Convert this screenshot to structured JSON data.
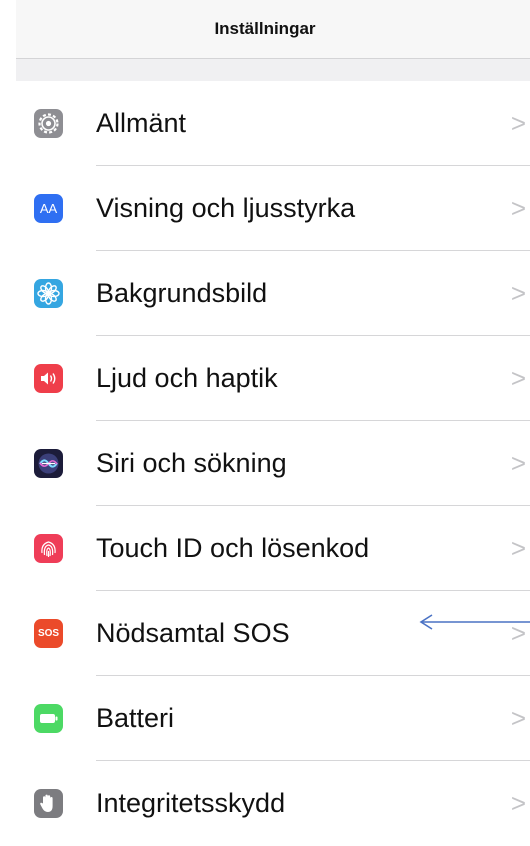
{
  "header": {
    "title": "Inställningar"
  },
  "settings": {
    "items": [
      {
        "label": "Allmänt",
        "icon": "gear-icon",
        "icon_color": "#8e8e93"
      },
      {
        "label": "Visning och ljusstyrka",
        "icon": "display-brightness-icon",
        "icon_color": "#2f6ff2",
        "icon_text": "AA"
      },
      {
        "label": "Bakgrundsbild",
        "icon": "wallpaper-flower-icon",
        "icon_color": "#35a6e1"
      },
      {
        "label": "Ljud och haptik",
        "icon": "speaker-icon",
        "icon_color": "#ef3e4a"
      },
      {
        "label": "Siri och sökning",
        "icon": "siri-icon",
        "icon_color": "#1c1c3a"
      },
      {
        "label": "Touch ID och lösenkod",
        "icon": "fingerprint-icon",
        "icon_color": "#ef3d58"
      },
      {
        "label": "Nödsamtal SOS",
        "icon": "sos-icon",
        "icon_color": "#eb4a2a",
        "icon_text": "SOS"
      },
      {
        "label": "Batteri",
        "icon": "battery-icon",
        "icon_color": "#4cd964"
      },
      {
        "label": "Integritetsskydd",
        "icon": "hand-icon",
        "icon_color": "#7c7c80"
      }
    ],
    "chevron": ">"
  },
  "annotation": {
    "arrow_color": "#4a72c4",
    "arrow_target": "Nödsamtal SOS"
  }
}
